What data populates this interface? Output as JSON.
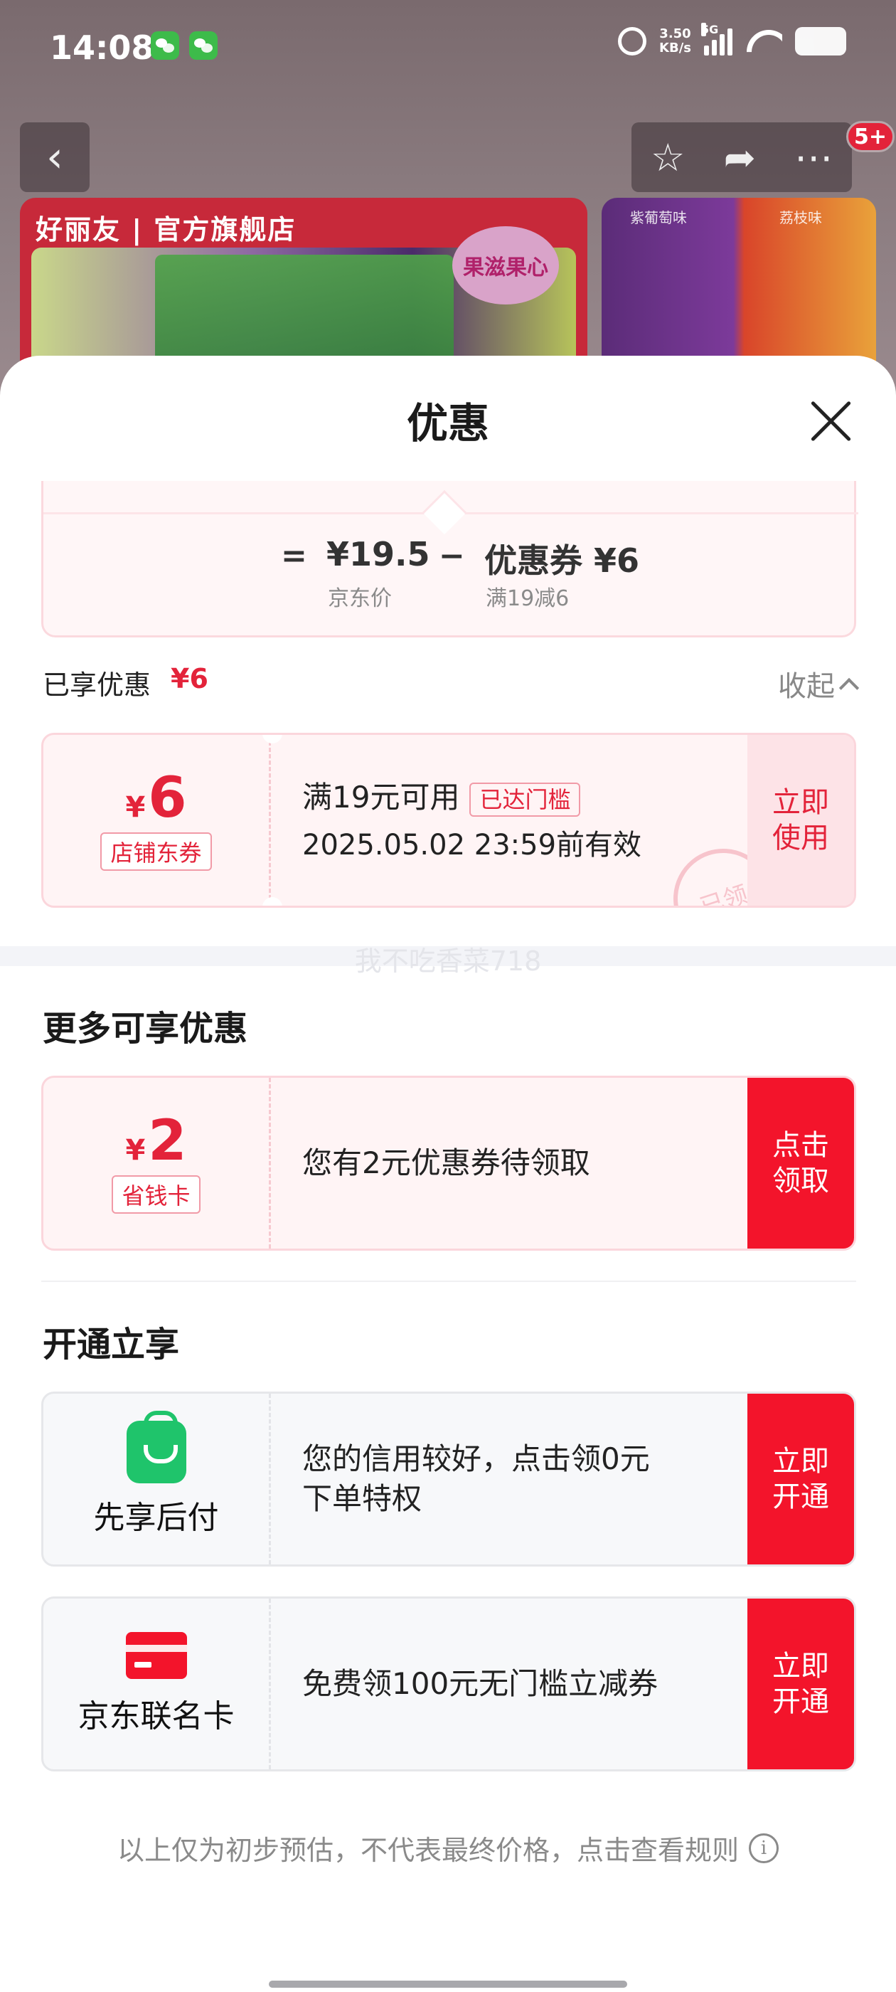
{
  "status_bar": {
    "time": "14:08",
    "net_speed_value": "3.50",
    "net_speed_unit": "KB/s",
    "network": "5G"
  },
  "background": {
    "nav_badge": "5+",
    "banner_brand": "好丽友 | 官方旗舰店",
    "banner_tag": "果滋果心",
    "side_labels": [
      "紫葡萄味",
      "荔枝味"
    ]
  },
  "sheet": {
    "title": "优惠"
  },
  "calc": {
    "equals": "=",
    "price": "¥19.5",
    "price_label": "京东价",
    "minus": "−",
    "coupon": "优惠券 ¥6",
    "coupon_label": "满19减6"
  },
  "enjoyed": {
    "label": "已享优惠",
    "amount": "¥6",
    "collapse_label": "收起"
  },
  "store_coupon": {
    "currency": "¥",
    "value": "6",
    "tag": "店铺东券",
    "condition": "满19元可用",
    "reached_tag": "已达门槛",
    "validity": "2025.05.02 23:59前有效",
    "action": "立即\n使用",
    "stamp": "已领"
  },
  "watermark": "我不吃香菜718",
  "more_section": {
    "title": "更多可享优惠",
    "card": {
      "currency": "¥",
      "value": "2",
      "tag": "省钱卡",
      "text": "您有2元优惠券待领取",
      "action": "点击\n领取"
    }
  },
  "open_section": {
    "title": "开通立享",
    "pay_later": {
      "name": "先享后付",
      "text": "您的信用较好，点击领0元\n下单特权",
      "action": "立即\n开通"
    },
    "cobrand_card": {
      "name": "京东联名卡",
      "text": "免费领100元无门槛立减券",
      "action": "立即\n开通"
    }
  },
  "footer": {
    "note": "以上仅为初步预估，不代表最终价格，点击查看规则"
  },
  "colors": {
    "accent": "#f3142b",
    "price_red": "#e3233a",
    "pay_green": "#1fc46b"
  }
}
